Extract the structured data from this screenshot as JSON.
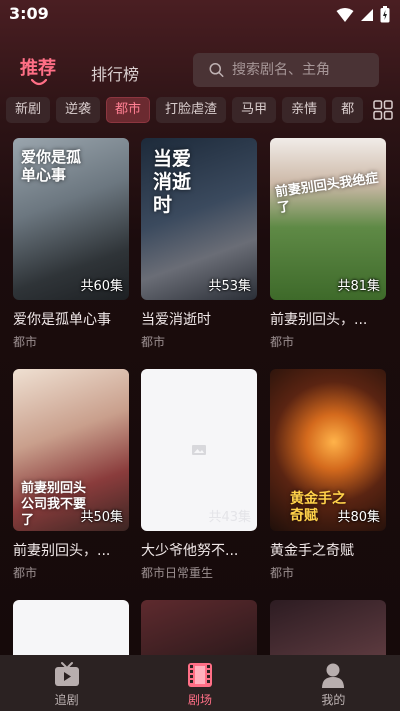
{
  "status": {
    "time": "3:09"
  },
  "header": {
    "tab_recommend": "推荐",
    "tab_ranking": "排行榜",
    "search_placeholder": "搜索剧名、主角"
  },
  "categories": [
    "新剧",
    "逆袭",
    "都市",
    "打脸虐渣",
    "马甲",
    "亲情",
    "都"
  ],
  "active_category": "都市",
  "dramas": [
    {
      "name": "爱你是孤单心事",
      "genre": "都市",
      "episodes": "共60集",
      "poster_title": "爱你是孤单心事"
    },
    {
      "name": "当爱消逝时",
      "genre": "都市",
      "episodes": "共53集",
      "poster_title": "当爱消逝时"
    },
    {
      "name": "前妻别回头，...",
      "genre": "都市",
      "episodes": "共81集",
      "poster_title": "前妻别回头我绝症了"
    },
    {
      "name": "前妻别回头，...",
      "genre": "都市",
      "episodes": "共50集",
      "poster_title": "前妻别回头公司我不要了"
    },
    {
      "name": "大少爷他努不...",
      "genre": "都市日常重生",
      "episodes": "共43集",
      "poster_title": ""
    },
    {
      "name": "黄金手之奇赋",
      "genre": "都市",
      "episodes": "共80集",
      "poster_title": "黄金手之奇赋"
    }
  ],
  "nav": {
    "chase": "追剧",
    "theater": "剧场",
    "mine": "我的"
  },
  "colors": {
    "accent": "#ff6f86",
    "background": "#170b0b",
    "nav_bg": "#2b2222"
  }
}
